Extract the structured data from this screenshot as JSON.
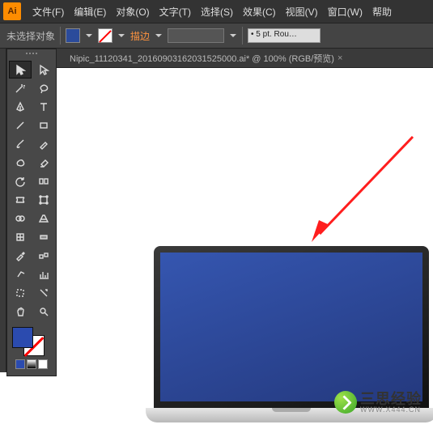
{
  "app": {
    "logo": "Ai"
  },
  "menu": {
    "file": "文件(F)",
    "edit": "编辑(E)",
    "object": "对象(O)",
    "type": "文字(T)",
    "select": "选择(S)",
    "effect": "效果(C)",
    "view": "视图(V)",
    "window": "窗口(W)",
    "help": "帮助"
  },
  "options": {
    "no_selection": "未选择对象",
    "stroke_label": "描边",
    "round_field": "• 5 pt. Rou…"
  },
  "colors": {
    "fill": "#2b4baf",
    "stroke_none": true
  },
  "tab": {
    "title": "Nipic_11120341_20160903162031525000.ai* @ 100% (RGB/预览)",
    "close": "×"
  },
  "zoom": "100%",
  "color_mode": "RGB/预览",
  "watermark": {
    "cn": "三思经验",
    "en": "WWW.X444.CN"
  }
}
